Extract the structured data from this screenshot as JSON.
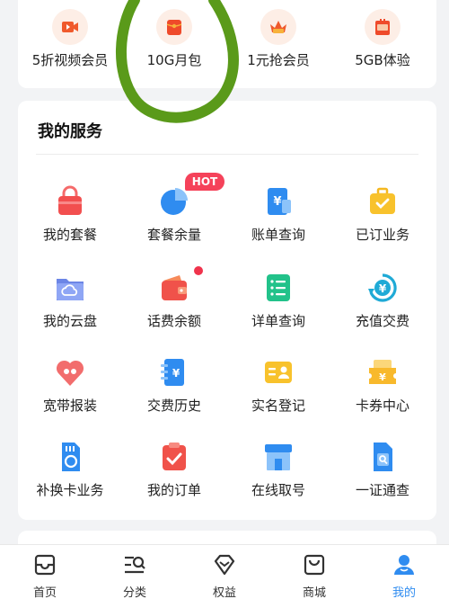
{
  "top_shortcuts": [
    {
      "label": "5折视频会员",
      "icon": "video-icon"
    },
    {
      "label": "10G月包",
      "icon": "red-packet-icon"
    },
    {
      "label": "1元抢会员",
      "icon": "crown-icon"
    },
    {
      "label": "5GB体验",
      "icon": "gift-bag-icon"
    }
  ],
  "services": {
    "title": "我的服务",
    "hot_badge": "HOT",
    "items": [
      {
        "label": "我的套餐",
        "icon": "bag-icon"
      },
      {
        "label": "套餐余量",
        "icon": "pie-chart-icon"
      },
      {
        "label": "账单查询",
        "icon": "bill-icon"
      },
      {
        "label": "已订业务",
        "icon": "briefcase-icon"
      },
      {
        "label": "我的云盘",
        "icon": "cloud-folder-icon"
      },
      {
        "label": "话费余额",
        "icon": "wallet-icon"
      },
      {
        "label": "详单查询",
        "icon": "list-icon"
      },
      {
        "label": "充值交费",
        "icon": "yuan-refresh-icon"
      },
      {
        "label": "宽带报装",
        "icon": "heart-router-icon"
      },
      {
        "label": "交费历史",
        "icon": "receipt-icon"
      },
      {
        "label": "实名登记",
        "icon": "id-card-icon"
      },
      {
        "label": "卡券中心",
        "icon": "coupon-icon"
      },
      {
        "label": "补换卡业务",
        "icon": "sim-swap-icon"
      },
      {
        "label": "我的订单",
        "icon": "clipboard-check-icon"
      },
      {
        "label": "在线取号",
        "icon": "store-icon"
      },
      {
        "label": "一证通查",
        "icon": "sim-search-icon"
      }
    ]
  },
  "bottom_nav": [
    {
      "label": "首页",
      "icon": "home-icon"
    },
    {
      "label": "分类",
      "icon": "category-search-icon"
    },
    {
      "label": "权益",
      "icon": "diamond-icon"
    },
    {
      "label": "商城",
      "icon": "shopping-bag-icon"
    },
    {
      "label": "我的",
      "icon": "profile-icon",
      "active": true
    }
  ],
  "colors": {
    "accent": "#2f8cf0",
    "hot": "#f5425a",
    "annotation": "#5a9a1a"
  }
}
